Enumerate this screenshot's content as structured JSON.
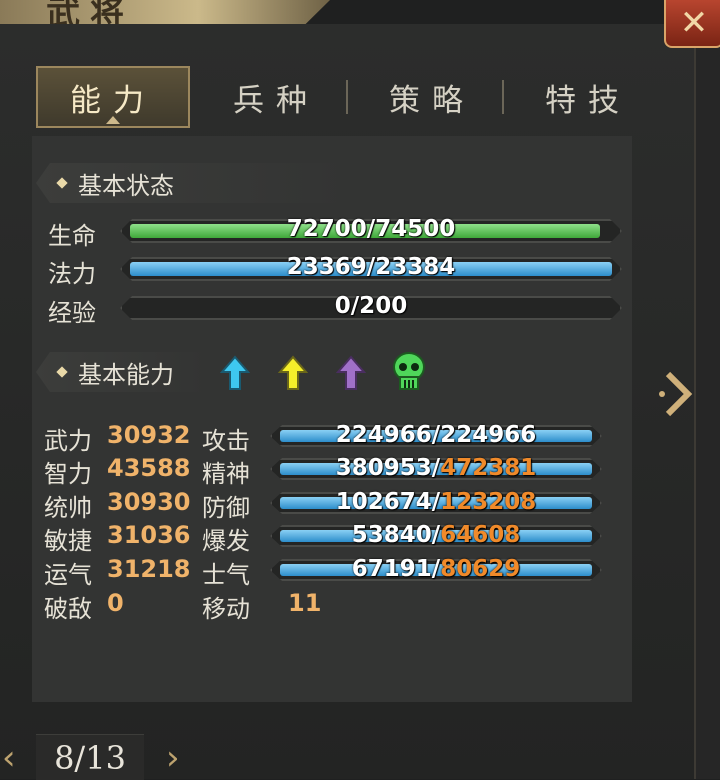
{
  "window": {
    "title": "武将",
    "close_icon": "close-icon"
  },
  "tabs": [
    {
      "label": "能力",
      "active": true
    },
    {
      "label": "兵种",
      "active": false
    },
    {
      "label": "策略",
      "active": false
    },
    {
      "label": "特技",
      "active": false
    }
  ],
  "basic_status": {
    "title": "基本状态",
    "rows": [
      {
        "label": "生命",
        "text": "72700/74500",
        "current": 72700,
        "max": 74500,
        "color": "#3fa83a"
      },
      {
        "label": "法力",
        "text": "23369/23384",
        "current": 23369,
        "max": 23384,
        "color": "#2d8ecb"
      },
      {
        "label": "经验",
        "text": "0/200",
        "current": 0,
        "max": 200,
        "color": "#2d8ecb"
      }
    ]
  },
  "basic_ability": {
    "title": "基本能力",
    "icons": [
      {
        "name": "cyan-arrow-up-icon",
        "color": "#3ec8f0"
      },
      {
        "name": "yellow-arrow-up-icon",
        "color": "#f4ee2a"
      },
      {
        "name": "purple-arrow-up-icon",
        "color": "#a070c8"
      },
      {
        "name": "green-skull-icon",
        "color": "#4fd65a"
      }
    ],
    "attributes": [
      {
        "name": "武力",
        "value": "30932",
        "sub_name": "攻击",
        "cur": "224966",
        "sep": "/",
        "max": "224966",
        "cur_n": 224966,
        "max_n": 224966,
        "max_orange": false
      },
      {
        "name": "智力",
        "value": "43588",
        "sub_name": "精神",
        "cur": "380953",
        "sep": "/",
        "max": "472381",
        "cur_n": 380953,
        "max_n": 472381,
        "max_orange": true
      },
      {
        "name": "统帅",
        "value": "30930",
        "sub_name": "防御",
        "cur": "102674",
        "sep": "/",
        "max": "123208",
        "cur_n": 102674,
        "max_n": 123208,
        "max_orange": true
      },
      {
        "name": "敏捷",
        "value": "31036",
        "sub_name": "爆发",
        "cur": "53840",
        "sep": "/",
        "max": "64608",
        "cur_n": 53840,
        "max_n": 64608,
        "max_orange": true
      },
      {
        "name": "运气",
        "value": "31218",
        "sub_name": "士气",
        "cur": "67191",
        "sep": "/",
        "max": "80629",
        "cur_n": 67191,
        "max_n": 80629,
        "max_orange": true
      }
    ],
    "po_di": {
      "name": "破敌",
      "value": "0"
    },
    "move": {
      "name": "移动",
      "value": "11"
    }
  },
  "pager": {
    "text": "8/13",
    "prev_icon": "chevron-left-icon",
    "next_icon": "chevron-right-icon"
  },
  "side_next_icon": "chevron-right-icon"
}
